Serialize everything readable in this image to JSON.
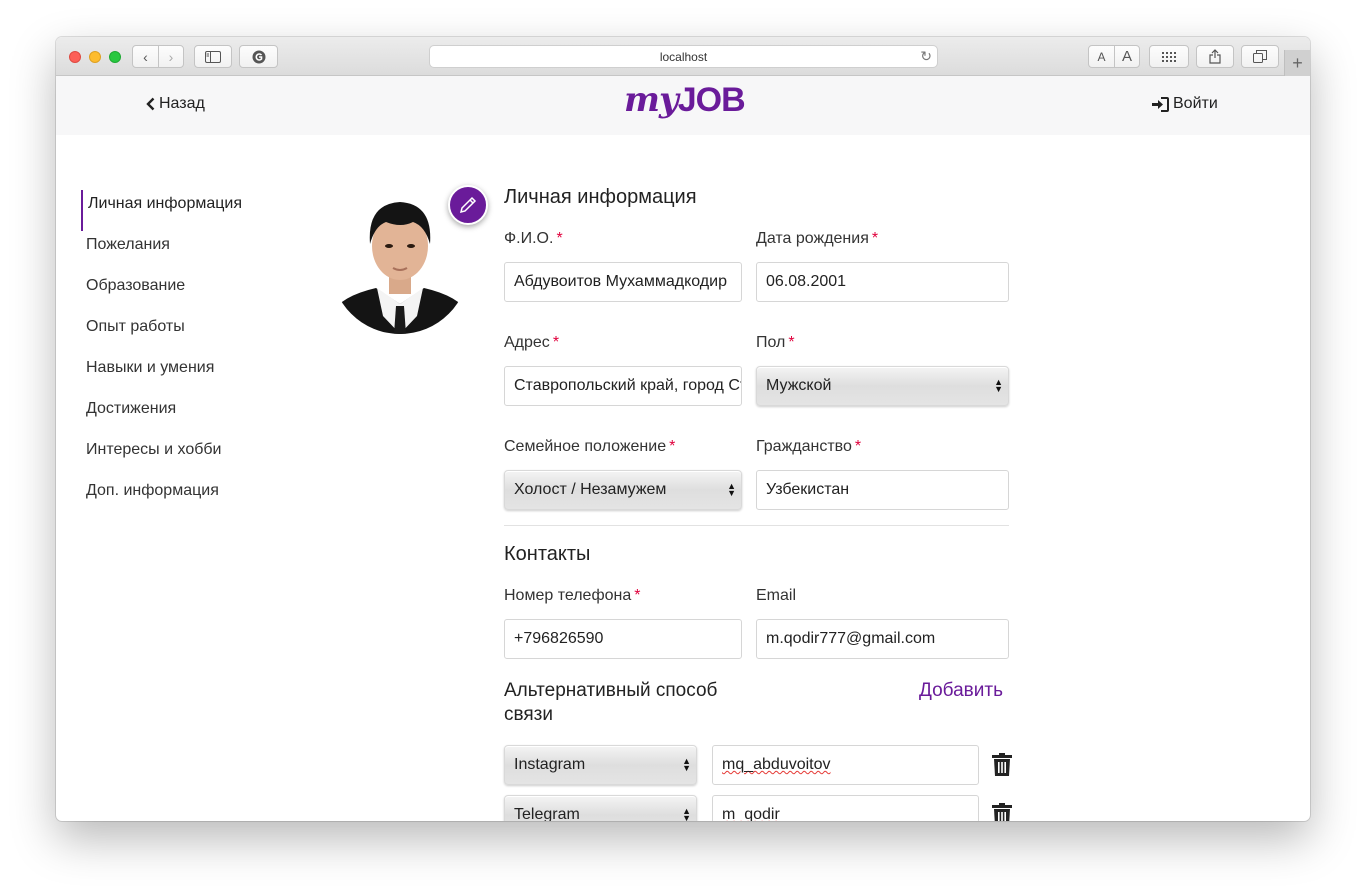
{
  "browser": {
    "url": "localhost"
  },
  "header": {
    "back_label": "Назад",
    "logo_my": "my",
    "logo_job": "JOB",
    "login_label": "Войти"
  },
  "sidebar": {
    "items": [
      {
        "label": "Личная информация",
        "active": true
      },
      {
        "label": "Пожелания"
      },
      {
        "label": "Образование"
      },
      {
        "label": "Опыт работы"
      },
      {
        "label": "Навыки и умения"
      },
      {
        "label": "Достижения"
      },
      {
        "label": "Интересы и хобби"
      },
      {
        "label": "Доп. информация"
      }
    ]
  },
  "personal": {
    "title": "Личная информация",
    "fio_label": "Ф.И.О.",
    "fio_value": "Абдувоитов Мухаммадкодир",
    "birth_label": "Дата рождения",
    "birth_value": "06.08.2001",
    "address_label": "Адрес",
    "address_value": "Ставропольский край, город Ставрополь",
    "gender_label": "Пол",
    "gender_value": "Мужской",
    "marital_label": "Семейное положение",
    "marital_value": "Холост / Незамужем",
    "citizenship_label": "Гражданство",
    "citizenship_value": "Узбекистан",
    "required_mark": "*"
  },
  "contacts": {
    "title": "Контакты",
    "phone_label": "Номер телефона",
    "phone_value": "+796826590",
    "email_label": "Email",
    "email_value": "m.qodir777@gmail.com",
    "alt_title_line1": "Альтернативный способ",
    "alt_title_line2": "связи",
    "add_label": "Добавить",
    "alt": [
      {
        "type": "Instagram",
        "value": "mq_abduvoitov"
      },
      {
        "type": "Telegram",
        "value": "m_qodir"
      }
    ]
  },
  "colors": {
    "accent": "#6a1b9a",
    "required": "#e0003c"
  }
}
